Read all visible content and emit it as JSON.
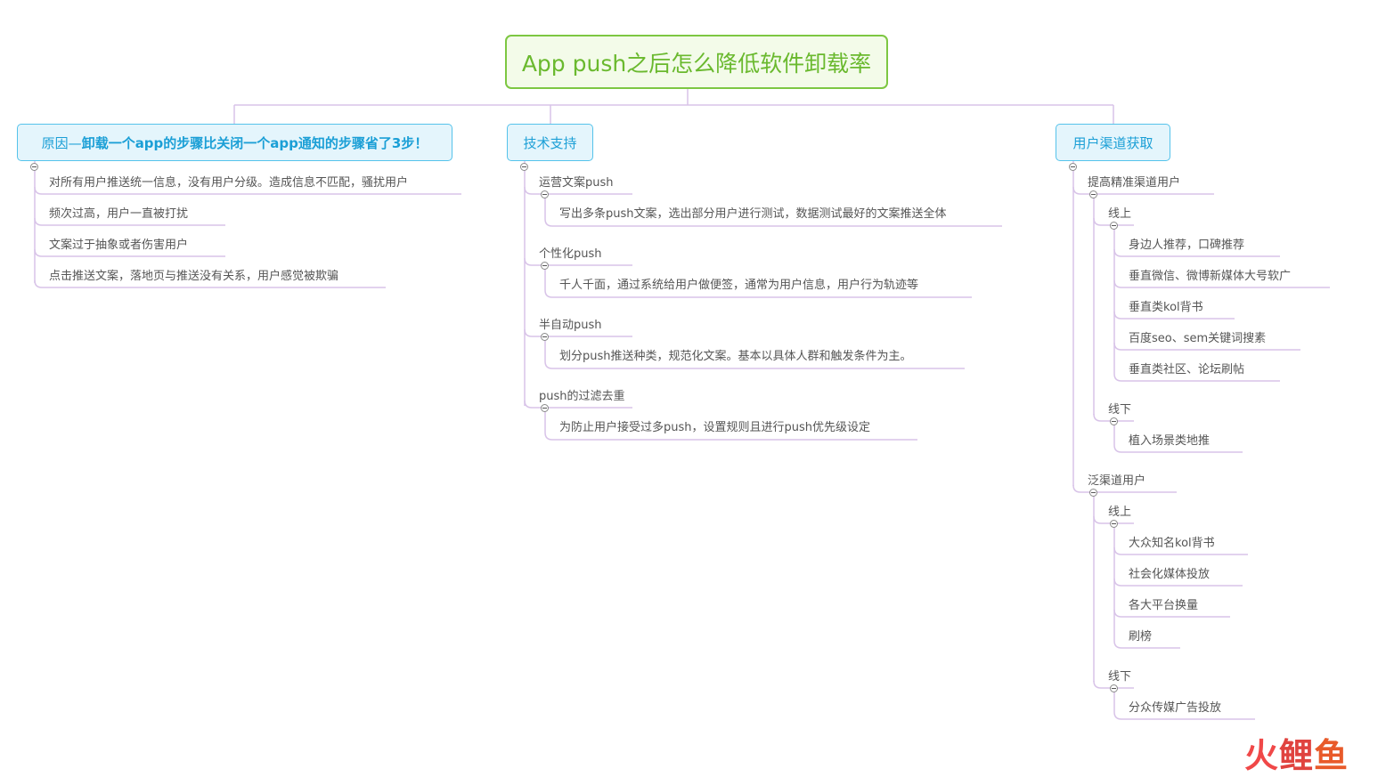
{
  "root": {
    "title": "App push之后怎么降低软件卸载率"
  },
  "branches": {
    "reason": {
      "label_prefix": "原因—",
      "label_bold": "卸载一个app的步骤比关闭一个app通知的步骤省了3步！",
      "items": [
        "对所有用户推送统一信息，没有用户分级。造成信息不匹配，骚扰用户",
        "频次过高，用户一直被打扰",
        "文案过于抽象或者伤害用户",
        "点击推送文案，落地页与推送没有关系，用户感觉被欺骗"
      ]
    },
    "tech": {
      "label": "技术支持",
      "groups": [
        {
          "title": "运营文案push",
          "detail": "写出多条push文案，选出部分用户进行测试，数据测试最好的文案推送全体"
        },
        {
          "title": "个性化push",
          "detail": "千人千面，通过系统给用户做便签，通常为用户信息，用户行为轨迹等"
        },
        {
          "title": "半自动push",
          "detail": "划分push推送种类，规范化文案。基本以具体人群和触发条件为主。"
        },
        {
          "title": "push的过滤去重",
          "detail": "为防止用户接受过多push，设置规则且进行push优先级设定"
        }
      ]
    },
    "channel": {
      "label": "用户渠道获取",
      "precise": {
        "title": "提高精准渠道用户",
        "online_label": "线上",
        "online": [
          "身边人推荐，口碑推荐",
          "垂直微信、微博新媒体大号软广",
          "垂直类kol背书",
          "百度seo、sem关键词搜素",
          "垂直类社区、论坛刷帖"
        ],
        "offline_label": "线下",
        "offline": [
          "植入场景类地推"
        ]
      },
      "broad": {
        "title": "泛渠道用户",
        "online_label": "线上",
        "online": [
          "大众知名kol背书",
          "社会化媒体投放",
          "各大平台换量",
          "刷榜"
        ],
        "offline_label": "线下",
        "offline": [
          "分众传媒广告投放"
        ]
      }
    }
  },
  "watermark": {
    "chars": [
      "火",
      "鲤",
      "鱼"
    ]
  },
  "colors": {
    "root_border": "#7dc742",
    "root_text": "#6ab92e",
    "branch_border": "#55c3eb",
    "branch_text": "#1b9fd6",
    "connector": "#d8c3e8"
  }
}
